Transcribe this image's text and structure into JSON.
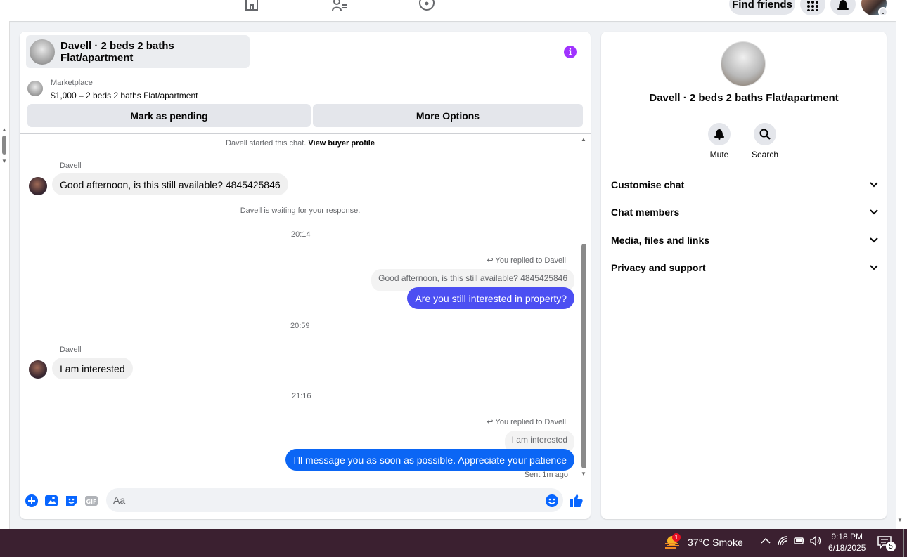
{
  "topnav": {
    "find_friends": "Find friends"
  },
  "chat": {
    "title": "Davell · 2 beds 2 baths Flat/apartment",
    "marketplace_label": "Marketplace",
    "listing": "$1,000 – 2 beds 2 baths Flat/apartment",
    "mark_pending": "Mark as pending",
    "more_options": "More Options",
    "started_text": "Davell started this chat.",
    "view_buyer": "View buyer profile",
    "waiting": "Davell is waiting for your response.",
    "composer_placeholder": "Aa",
    "sent": "Sent 1m ago",
    "messages": [
      {
        "sender": "Davell",
        "text": "Good afternoon, is this still available? 4845425846"
      },
      {
        "time": "20:14"
      },
      {
        "replied": "You replied to Davell",
        "quote": "Good afternoon, is this still available? 4845425846",
        "text": "Are you still interested in property?"
      },
      {
        "time": "20:59"
      },
      {
        "sender": "Davell",
        "text": "I am interested"
      },
      {
        "time": "21:16"
      },
      {
        "replied": "You replied to Davell",
        "quote": "I am interested",
        "text": "I'll message you as soon as possible. Appreciate your patience"
      }
    ]
  },
  "side": {
    "title": "Davell · 2 beds 2 baths Flat/apartment",
    "mute": "Mute",
    "search": "Search",
    "sections": [
      "Customise chat",
      "Chat members",
      "Media, files and links",
      "Privacy and support"
    ]
  },
  "taskbar": {
    "weather_badge": "1",
    "weather": "37°C  Smoke",
    "time": "9:18 PM",
    "date": "6/18/2025",
    "notif_count": "5"
  },
  "colors": {
    "outgoing_bubble": "#4c4ff2",
    "outgoing_bubble_2": "#0b66f5",
    "info_icon": "#a033ff",
    "taskbar": "#3b2030"
  }
}
